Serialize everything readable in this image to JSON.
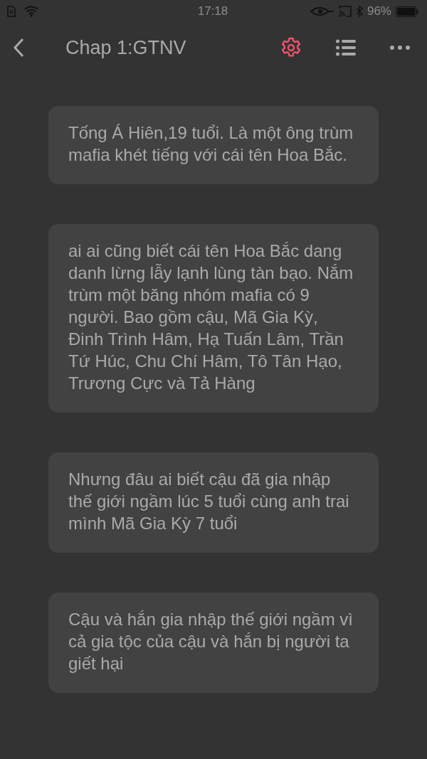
{
  "status_bar": {
    "time": "17:18",
    "battery": "96%"
  },
  "header": {
    "title": "Chap 1:GTNV"
  },
  "paragraphs": [
    "Tống Á Hiên,19 tuổi. Là một ông trùm mafia khét tiếng với cái tên Hoa Bắc.",
    "ai ai cũng biết cái tên Hoa Bắc dang danh lừng lẫy lạnh lùng tàn bạo. Nắm trùm một băng nhóm mafia có 9 người. Bao gồm cậu, Mã Gia Kỳ, Đinh Trình Hâm, Hạ Tuấn Lâm, Trần Tứ Húc, Chu Chí Hâm, Tô Tân Hạo, Trương Cực và Tả Hàng",
    "Nhưng đâu ai biết cậu đã gia nhập thế giới ngầm lúc 5 tuổi cùng anh trai mình Mã Gia Kỳ 7 tuổi",
    "Cậu và hắn gia nhập thế giới ngầm vì cả gia tộc của cậu và hắn bị người ta giết hại"
  ]
}
